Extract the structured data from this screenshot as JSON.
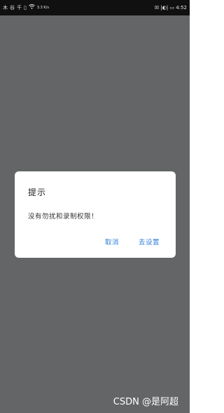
{
  "status_bar": {
    "left_glyphs": [
      "木",
      "谷",
      "千",
      "▯",
      "◉",
      "ⅹ"
    ],
    "mini_text": "3.3\nK/s",
    "right_text": "☒ |◐| ▭ 4:52"
  },
  "dialog": {
    "title": "提示",
    "message": "没有勿扰和录制权限！",
    "cancel_label": "取消",
    "settings_label": "去设置"
  },
  "watermark": "CSDN @是阿超"
}
